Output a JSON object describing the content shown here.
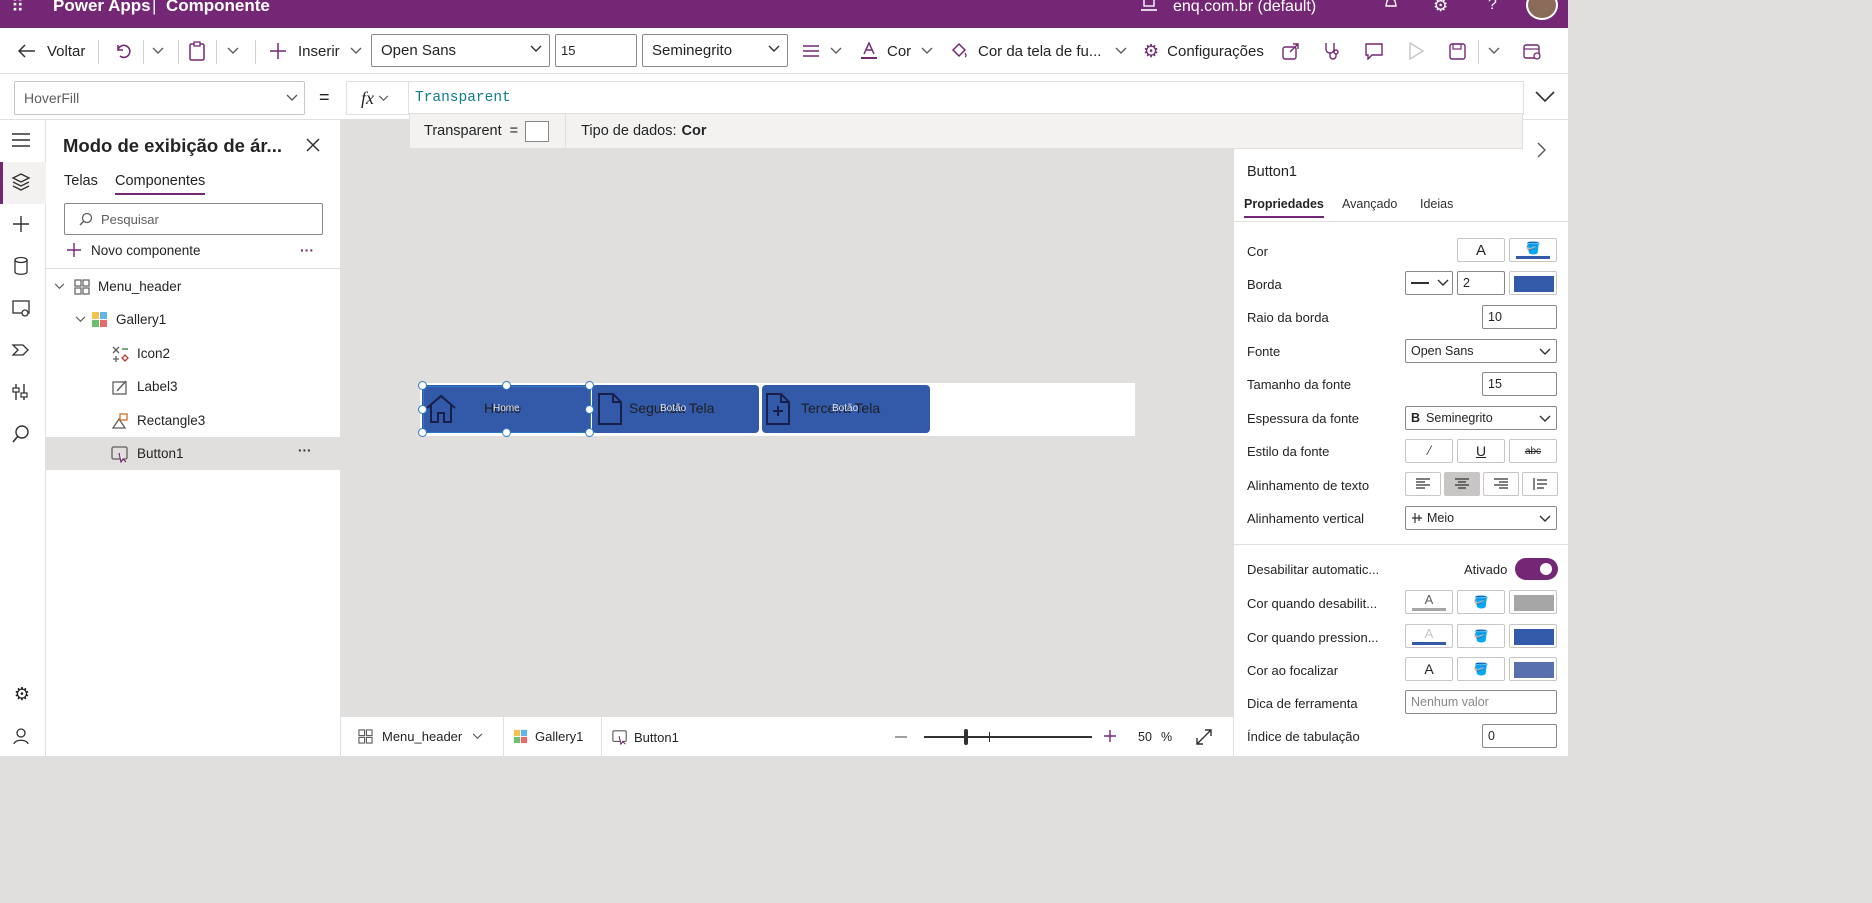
{
  "topbar": {
    "app": "Power Apps",
    "divider": "|",
    "title": "Componente",
    "env": "enq.com.br (default)"
  },
  "commands": {
    "back": "Voltar",
    "insert": "Inserir",
    "font": "Open Sans",
    "font_size": "15",
    "font_weight": "Seminegrito",
    "color": "Cor",
    "screen_color": "Cor da tela de fu...",
    "settings": "Configurações"
  },
  "formula": {
    "property": "HoverFill",
    "equals": "=",
    "fx": "fx",
    "value": "Transparent",
    "hint_name": "Transparent",
    "hint_eq": "=",
    "hint_type_label": "Tipo de dados:",
    "hint_type_value": "Cor"
  },
  "tree": {
    "title": "Modo de exibição de ár...",
    "tabs": [
      "Telas",
      "Componentes"
    ],
    "search_placeholder": "Pesquisar",
    "new_component": "Novo componente",
    "more": "···",
    "nodes": [
      "Menu_header",
      "Gallery1",
      "Icon2",
      "Label3",
      "Rectangle3",
      "Button1"
    ]
  },
  "canvas": {
    "buttons": [
      {
        "label": "Home",
        "overlay": "Home"
      },
      {
        "label": "Segunda Tela",
        "overlay": "Botão"
      },
      {
        "label": "Terceira Tela",
        "overlay": "Botão"
      }
    ]
  },
  "bottombar": {
    "crumbs": [
      "Menu_header",
      "Gallery1",
      "Button1"
    ],
    "zoom": "50",
    "zoom_unit": "%",
    "zoom_fraction": 0.5
  },
  "props": {
    "control": "Button1",
    "tabs": [
      "Propriedades",
      "Avançado",
      "Ideias"
    ],
    "cor": "Cor",
    "borda": "Borda",
    "borda_value": "2",
    "raio": "Raio da borda",
    "raio_value": "10",
    "fonte": "Fonte",
    "fonte_value": "Open Sans",
    "tamanho": "Tamanho da fonte",
    "tamanho_value": "15",
    "espessura": "Espessura da fonte",
    "espessura_value": "Seminegrito",
    "estilo": "Estilo da fonte",
    "alinhamento": "Alinhamento de texto",
    "alinhamento_v": "Alinhamento vertical",
    "alinhamento_v_value": "Meio",
    "desabilitar": "Desabilitar automatic...",
    "ativado": "Ativado",
    "cor_desab": "Cor quando desabilit...",
    "cor_press": "Cor quando pression...",
    "cor_foco": "Cor ao focalizar",
    "dica": "Dica de ferramenta",
    "dica_placeholder": "Nenhum valor",
    "indice": "Índice de tabulação",
    "indice_value": "0",
    "colors": {
      "border": "#3359a9",
      "disabled": "#a6a6a6",
      "pressed": "#3359a9",
      "focus": "#5870ad",
      "brand": "#742774"
    }
  }
}
